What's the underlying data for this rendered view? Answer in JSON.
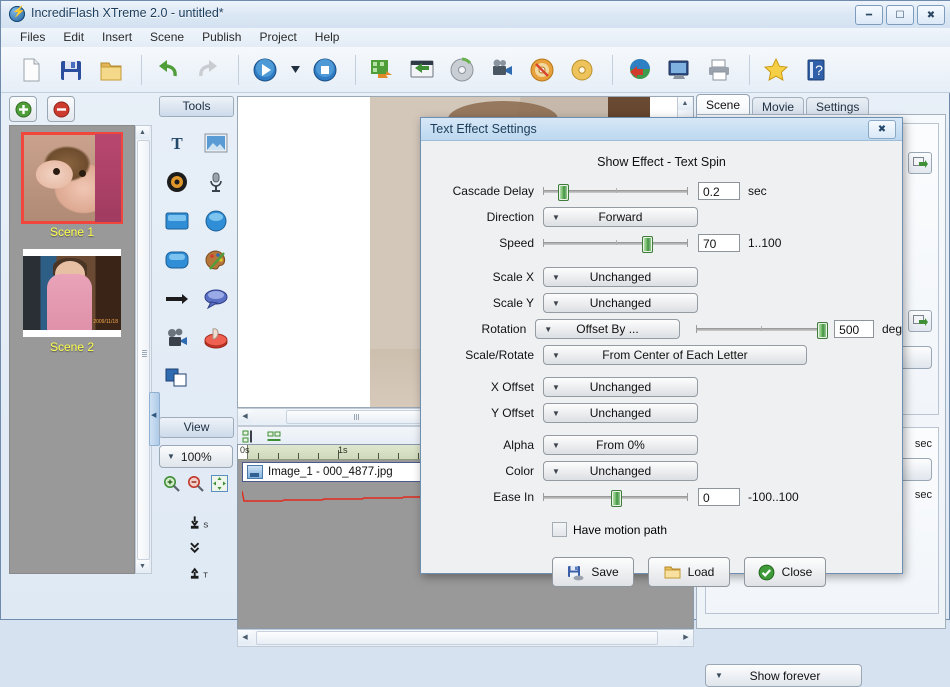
{
  "window": {
    "title": "IncrediFlash XTreme 2.0 - untitled*",
    "app_icon": "lightning-bolt-icon",
    "minimize_label": "➖",
    "maximize_label": "□",
    "close_label": "✕"
  },
  "menubar": {
    "items": [
      "Files",
      "Edit",
      "Insert",
      "Scene",
      "Publish",
      "Project",
      "Help"
    ]
  },
  "toolbar": {
    "groups": [
      [
        {
          "name": "new-document-icon",
          "title": "New"
        },
        {
          "name": "save-icon",
          "title": "Save"
        },
        {
          "name": "open-folder-icon",
          "title": "Open"
        }
      ],
      [
        {
          "name": "undo-icon",
          "title": "Undo"
        },
        {
          "name": "redo-icon",
          "title": "Redo"
        }
      ],
      [
        {
          "name": "play-icon",
          "title": "Play"
        },
        {
          "name": "play-dropdown-icon",
          "title": "Play options"
        },
        {
          "name": "stop-icon",
          "title": "Stop"
        }
      ],
      [
        {
          "name": "export-flash-icon",
          "title": "Export Flash"
        },
        {
          "name": "window-back-icon",
          "title": "Window"
        },
        {
          "name": "disc-icon",
          "title": "Disc"
        },
        {
          "name": "camera-icon",
          "title": "Camera"
        },
        {
          "name": "burn-cd-icon",
          "title": "Burn CD"
        },
        {
          "name": "cd-icon",
          "title": "CD"
        }
      ],
      [
        {
          "name": "globe-upload-icon",
          "title": "Publish to web"
        },
        {
          "name": "monitor-icon",
          "title": "Preview on screen"
        },
        {
          "name": "printer-icon",
          "title": "Print"
        }
      ],
      [
        {
          "name": "favorite-star-icon",
          "title": "Favorites"
        },
        {
          "name": "help-book-icon",
          "title": "Help"
        }
      ]
    ]
  },
  "scene_panel": {
    "add_button_label": "+",
    "remove_button_label": "−",
    "scenes": [
      {
        "label": "Scene 1",
        "selected": true
      },
      {
        "label": "Scene 2",
        "selected": false
      }
    ]
  },
  "tools_panel": {
    "caption": "Tools",
    "tools": [
      {
        "name": "text-tool-icon",
        "label": "Text"
      },
      {
        "name": "image-tool-icon",
        "label": "Image"
      },
      {
        "name": "sound-tool-icon",
        "label": "Sound"
      },
      {
        "name": "microphone-tool-icon",
        "label": "Microphone"
      },
      {
        "name": "rectangle-tool-icon",
        "label": "Rectangle"
      },
      {
        "name": "circle-tool-icon",
        "label": "Circle"
      },
      {
        "name": "rounded-rect-tool-icon",
        "label": "Rounded Rectangle"
      },
      {
        "name": "palette-tool-icon",
        "label": "Palette"
      },
      {
        "name": "arrow-tool-icon",
        "label": "Arrow"
      },
      {
        "name": "speech-bubble-tool-icon",
        "label": "Speech Bubble"
      },
      {
        "name": "video-tool-icon",
        "label": "Video"
      },
      {
        "name": "button-tool-icon",
        "label": "Button"
      },
      {
        "name": "layers-tool-icon",
        "label": "Layers"
      }
    ]
  },
  "view_panel": {
    "caption": "View",
    "zoom_value": "100%",
    "icons": [
      {
        "name": "zoom-in-icon"
      },
      {
        "name": "zoom-out-icon"
      },
      {
        "name": "fit-to-window-icon"
      }
    ],
    "stack_icons": [
      {
        "name": "send-to-start-icon",
        "label": "S"
      },
      {
        "name": "send-down-icon",
        "label": ""
      },
      {
        "name": "bring-to-top-icon",
        "label": "T"
      }
    ]
  },
  "timeline": {
    "ruler_labels": [
      "0s",
      "1s"
    ],
    "tool_icons": [
      {
        "name": "align-objects-icon"
      },
      {
        "name": "distribute-objects-icon"
      }
    ],
    "tracks": [
      {
        "label": "Image_1 - 000_4877.jpg",
        "icon": "image-track-icon"
      }
    ]
  },
  "right_panel": {
    "tabs": [
      {
        "label": "Scene",
        "active": true
      },
      {
        "label": "Movie",
        "active": false
      },
      {
        "label": "Settings",
        "active": false
      }
    ],
    "partial_labels": [
      "sec",
      "sec",
      "sec"
    ],
    "icons": [
      {
        "name": "insert-frame-icon"
      },
      {
        "name": "insert-frame-icon"
      }
    ],
    "show_forever": {
      "label": "Show forever",
      "caret": "▼"
    }
  },
  "dialog": {
    "title": "Text Effect Settings",
    "close_label": "✖",
    "heading": "Show Effect - Text Spin",
    "rows": [
      {
        "label": "Cascade Delay",
        "type": "slider",
        "slider_percent": 10,
        "value": "0.2",
        "unit": "sec"
      },
      {
        "label": "Direction",
        "type": "combo",
        "value": "Forward",
        "caret": "▼",
        "width": "w155"
      },
      {
        "label": "Speed",
        "type": "slider",
        "slider_percent": 70,
        "value": "70",
        "unit": "1..100"
      },
      {
        "label": "Scale X",
        "type": "combo",
        "value": "Unchanged",
        "caret": "▼",
        "width": "w155"
      },
      {
        "label": "Scale Y",
        "type": "combo",
        "value": "Unchanged",
        "caret": "▼",
        "width": "w155"
      },
      {
        "label": "Rotation",
        "type": "combo-slider",
        "value": "Offset By ...",
        "caret": "▼",
        "width": "w155",
        "slider_percent": 95,
        "number": "500",
        "unit": "deg"
      },
      {
        "label": "Scale/Rotate",
        "type": "combo",
        "value": "From Center of Each Letter",
        "caret": "▼",
        "width": "w264"
      },
      {
        "label": "X Offset",
        "type": "combo",
        "value": "Unchanged",
        "caret": "▼",
        "width": "w155"
      },
      {
        "label": "Y Offset",
        "type": "combo",
        "value": "Unchanged",
        "caret": "▼",
        "width": "w155"
      },
      {
        "label": "Alpha",
        "type": "combo",
        "value": "From 0%",
        "caret": "▼",
        "width": "w155"
      },
      {
        "label": "Color",
        "type": "combo",
        "value": "Unchanged",
        "caret": "▼",
        "width": "w155"
      },
      {
        "label": "Ease In",
        "type": "slider",
        "slider_percent": 50,
        "value": "0",
        "unit": "-100..100"
      }
    ],
    "checkbox": {
      "label": "Have motion path",
      "checked": false
    },
    "buttons": [
      {
        "label": "Save",
        "icon": "save-icon"
      },
      {
        "label": "Load",
        "icon": "folder-icon"
      },
      {
        "label": "Close",
        "icon": "check-circle-icon"
      }
    ]
  },
  "colors": {
    "accent": "#3e8f42",
    "selection": "#f0463c",
    "scene_label": "#ffff4d",
    "title_text": "#1b3d5c"
  }
}
